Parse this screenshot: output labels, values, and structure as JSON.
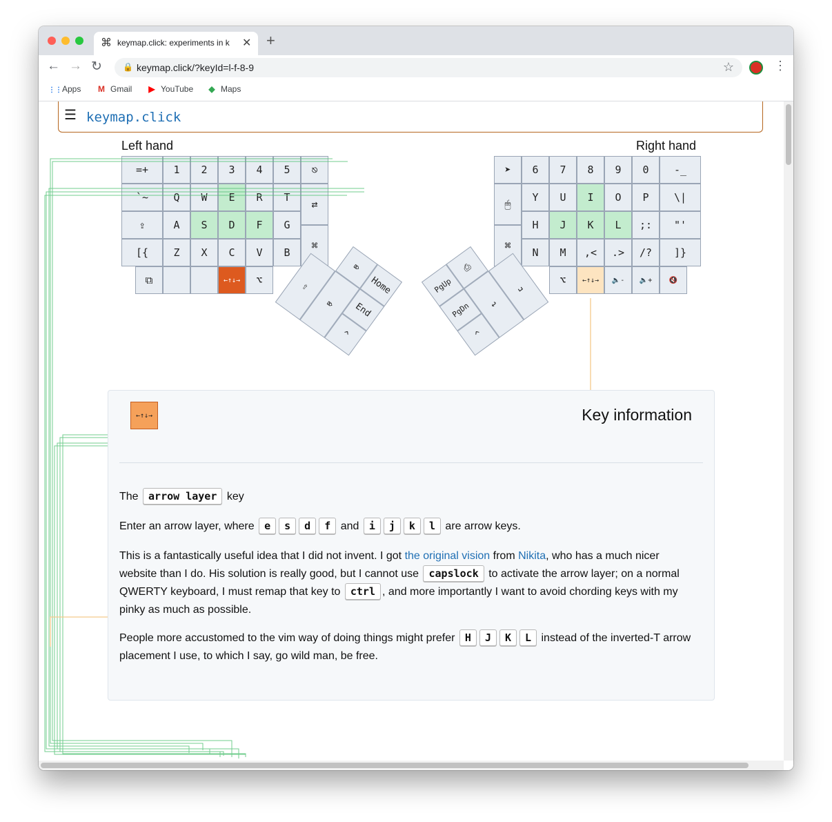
{
  "browser": {
    "tab_title": "keymap.click: experiments in k",
    "tab_icon": "⌘",
    "url": "keymap.click/?keyId=l-f-8-9",
    "bookmarks": [
      {
        "label": "Apps",
        "icon": "apps-grid-icon"
      },
      {
        "label": "Gmail",
        "icon": "gmail-icon"
      },
      {
        "label": "YouTube",
        "icon": "youtube-icon"
      },
      {
        "label": "Maps",
        "icon": "maps-icon"
      }
    ]
  },
  "site": {
    "brand": "keymap.click",
    "left_hand_label": "Left hand",
    "right_hand_label": "Right hand"
  },
  "keyboard": {
    "left": {
      "row1": [
        "=+",
        "1",
        "2",
        "3",
        "4",
        "5",
        "⎋"
      ],
      "row2": [
        "`~",
        "Q",
        "W",
        "E",
        "R",
        "T"
      ],
      "row3": [
        "⇪",
        "A",
        "S",
        "D",
        "F",
        "G"
      ],
      "row4": [
        "[{",
        "Z",
        "X",
        "C",
        "V",
        "B"
      ],
      "row5": [
        "⧉",
        "",
        "",
        "←↑↓→",
        "⌥"
      ],
      "inner_top": "⇄",
      "inner_bottom": "⌘",
      "thumb": [
        "⇧",
        "⌦",
        "Home",
        "End",
        "^",
        "⌦"
      ]
    },
    "right": {
      "row1": [
        "➤",
        "6",
        "7",
        "8",
        "9",
        "0",
        "-_"
      ],
      "row2": [
        "Y",
        "U",
        "I",
        "O",
        "P",
        "\\|"
      ],
      "row3": [
        "H",
        "J",
        "K",
        "L",
        ";:",
        "\"'"
      ],
      "row4": [
        "N",
        "M",
        ",<",
        ".>",
        "/?",
        "]}"
      ],
      "row5": [
        "⌥",
        "←↑↓→",
        "🔈-",
        "🔈+",
        "🔇"
      ],
      "inner_top": "🖱",
      "inner_bottom": "⌘",
      "thumb": [
        "PgUp",
        "⎙",
        "PgDn",
        "↩",
        "␣",
        "^"
      ]
    }
  },
  "info": {
    "key_label": "←↑↓→",
    "title": "Key information",
    "p1_pre": "The",
    "p1_key": "arrow layer",
    "p1_post": "key",
    "p2_pre": "Enter an arrow layer, where",
    "p2_keys_a": [
      "e",
      "s",
      "d",
      "f"
    ],
    "p2_and": "and",
    "p2_keys_b": [
      "i",
      "j",
      "k",
      "l"
    ],
    "p2_post": "are arrow keys.",
    "p3_a": "This is a fantastically useful idea that I did not invent. I got",
    "p3_link1": "the original vision",
    "p3_b": "from",
    "p3_link2": "Nikita",
    "p3_c": ", who has a much nicer website than I do. His solution is really good, but I cannot use",
    "p3_key1": "capslock",
    "p3_d": "to activate the arrow layer; on a normal QWERTY keyboard, I must remap that key to",
    "p3_key2": "ctrl",
    "p3_e": ", and more importantly I want to avoid chording keys with my pinky as much as possible.",
    "p4_a": "People more accustomed to the vim way of doing things might prefer",
    "p4_keys": [
      "H",
      "J",
      "K",
      "L"
    ],
    "p4_b": "instead of the inverted-T arrow placement I use, to which I say, go wild man, be free."
  },
  "colors": {
    "highlight_green": "#c3ecce",
    "selected_key": "#dd5a1f",
    "selected_key_light": "#f5a15a",
    "pale_orange": "#fde4c0",
    "link_blue": "#1f6fb4",
    "connector_green": "#58c47a",
    "connector_orange": "#f3c98a"
  }
}
